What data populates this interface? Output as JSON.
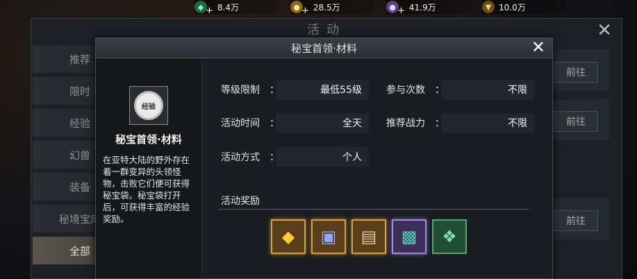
{
  "topbar": {
    "resources": [
      {
        "icon": "green-gem-icon",
        "value": "8.4万",
        "color": "#33c07a"
      },
      {
        "icon": "gold-coin-icon",
        "value": "28.5万",
        "color": "#d8a53a"
      },
      {
        "icon": "purple-coin-icon",
        "value": "41.9万",
        "color": "#a27ad6"
      },
      {
        "icon": "honor-badge-icon",
        "value": "10.0万",
        "color": "#d6a033"
      }
    ],
    "plus": "+"
  },
  "bg_window": {
    "title": "活动",
    "close": "✕",
    "sidebar": [
      "推荐",
      "限时",
      "经验",
      "幻兽",
      "装备",
      "秘境宝库",
      "全部"
    ],
    "active_index": 6,
    "goto_label": "前往"
  },
  "dialog": {
    "title": "秘宝首领·材料",
    "close": "✕",
    "icon_text": "经验",
    "name": "秘宝首领·材料",
    "description": "在亚特大陆的野外存在着一群变异的头领怪物，击败它们便可获得秘宝袋。秘宝袋打开后，可获得丰富的经验奖励。",
    "fields": {
      "level_label": "等级限制",
      "level_value": "最低55级",
      "times_label": "参与次数",
      "times_value": "不限",
      "time_label": "活动时间",
      "time_value": "全天",
      "power_label": "推荐战力",
      "power_value": "不限",
      "mode_label": "活动方式",
      "mode_value": "个人",
      "colon": "："
    },
    "reward_title": "活动奖励",
    "rewards": [
      {
        "icon": "gold-crystal-icon",
        "rarity": "gold"
      },
      {
        "icon": "gem-chest-icon",
        "rarity": "gold"
      },
      {
        "icon": "scroll-book-icon",
        "rarity": "gold"
      },
      {
        "icon": "dark-chest-icon",
        "rarity": "purple"
      },
      {
        "icon": "gift-box-egg-icon",
        "rarity": "green"
      }
    ]
  }
}
